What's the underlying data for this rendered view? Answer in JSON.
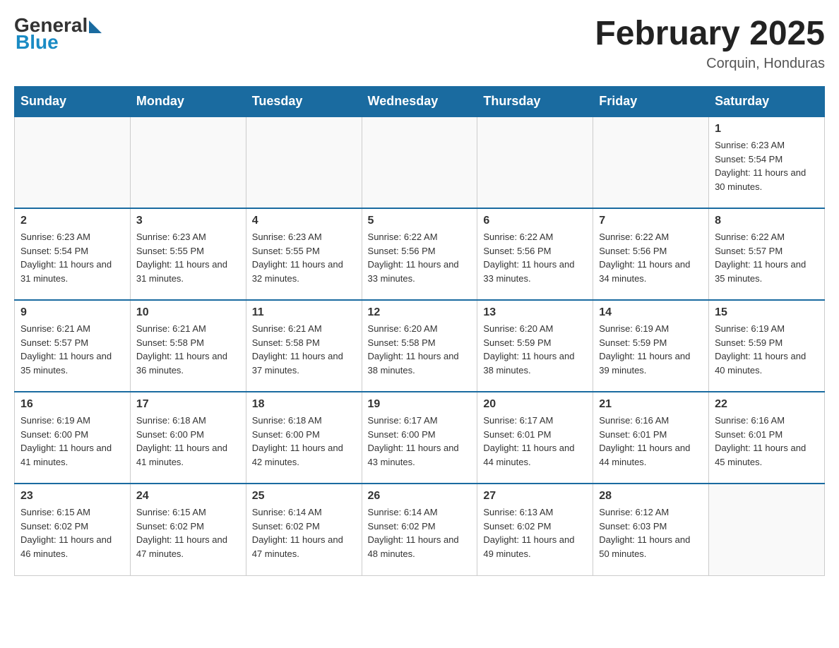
{
  "header": {
    "logo": {
      "general": "General",
      "blue": "Blue"
    },
    "title": "February 2025",
    "location": "Corquin, Honduras"
  },
  "days_of_week": [
    "Sunday",
    "Monday",
    "Tuesday",
    "Wednesday",
    "Thursday",
    "Friday",
    "Saturday"
  ],
  "weeks": [
    [
      {
        "day": "",
        "info": ""
      },
      {
        "day": "",
        "info": ""
      },
      {
        "day": "",
        "info": ""
      },
      {
        "day": "",
        "info": ""
      },
      {
        "day": "",
        "info": ""
      },
      {
        "day": "",
        "info": ""
      },
      {
        "day": "1",
        "sunrise": "Sunrise: 6:23 AM",
        "sunset": "Sunset: 5:54 PM",
        "daylight": "Daylight: 11 hours and 30 minutes."
      }
    ],
    [
      {
        "day": "2",
        "sunrise": "Sunrise: 6:23 AM",
        "sunset": "Sunset: 5:54 PM",
        "daylight": "Daylight: 11 hours and 31 minutes."
      },
      {
        "day": "3",
        "sunrise": "Sunrise: 6:23 AM",
        "sunset": "Sunset: 5:55 PM",
        "daylight": "Daylight: 11 hours and 31 minutes."
      },
      {
        "day": "4",
        "sunrise": "Sunrise: 6:23 AM",
        "sunset": "Sunset: 5:55 PM",
        "daylight": "Daylight: 11 hours and 32 minutes."
      },
      {
        "day": "5",
        "sunrise": "Sunrise: 6:22 AM",
        "sunset": "Sunset: 5:56 PM",
        "daylight": "Daylight: 11 hours and 33 minutes."
      },
      {
        "day": "6",
        "sunrise": "Sunrise: 6:22 AM",
        "sunset": "Sunset: 5:56 PM",
        "daylight": "Daylight: 11 hours and 33 minutes."
      },
      {
        "day": "7",
        "sunrise": "Sunrise: 6:22 AM",
        "sunset": "Sunset: 5:56 PM",
        "daylight": "Daylight: 11 hours and 34 minutes."
      },
      {
        "day": "8",
        "sunrise": "Sunrise: 6:22 AM",
        "sunset": "Sunset: 5:57 PM",
        "daylight": "Daylight: 11 hours and 35 minutes."
      }
    ],
    [
      {
        "day": "9",
        "sunrise": "Sunrise: 6:21 AM",
        "sunset": "Sunset: 5:57 PM",
        "daylight": "Daylight: 11 hours and 35 minutes."
      },
      {
        "day": "10",
        "sunrise": "Sunrise: 6:21 AM",
        "sunset": "Sunset: 5:58 PM",
        "daylight": "Daylight: 11 hours and 36 minutes."
      },
      {
        "day": "11",
        "sunrise": "Sunrise: 6:21 AM",
        "sunset": "Sunset: 5:58 PM",
        "daylight": "Daylight: 11 hours and 37 minutes."
      },
      {
        "day": "12",
        "sunrise": "Sunrise: 6:20 AM",
        "sunset": "Sunset: 5:58 PM",
        "daylight": "Daylight: 11 hours and 38 minutes."
      },
      {
        "day": "13",
        "sunrise": "Sunrise: 6:20 AM",
        "sunset": "Sunset: 5:59 PM",
        "daylight": "Daylight: 11 hours and 38 minutes."
      },
      {
        "day": "14",
        "sunrise": "Sunrise: 6:19 AM",
        "sunset": "Sunset: 5:59 PM",
        "daylight": "Daylight: 11 hours and 39 minutes."
      },
      {
        "day": "15",
        "sunrise": "Sunrise: 6:19 AM",
        "sunset": "Sunset: 5:59 PM",
        "daylight": "Daylight: 11 hours and 40 minutes."
      }
    ],
    [
      {
        "day": "16",
        "sunrise": "Sunrise: 6:19 AM",
        "sunset": "Sunset: 6:00 PM",
        "daylight": "Daylight: 11 hours and 41 minutes."
      },
      {
        "day": "17",
        "sunrise": "Sunrise: 6:18 AM",
        "sunset": "Sunset: 6:00 PM",
        "daylight": "Daylight: 11 hours and 41 minutes."
      },
      {
        "day": "18",
        "sunrise": "Sunrise: 6:18 AM",
        "sunset": "Sunset: 6:00 PM",
        "daylight": "Daylight: 11 hours and 42 minutes."
      },
      {
        "day": "19",
        "sunrise": "Sunrise: 6:17 AM",
        "sunset": "Sunset: 6:00 PM",
        "daylight": "Daylight: 11 hours and 43 minutes."
      },
      {
        "day": "20",
        "sunrise": "Sunrise: 6:17 AM",
        "sunset": "Sunset: 6:01 PM",
        "daylight": "Daylight: 11 hours and 44 minutes."
      },
      {
        "day": "21",
        "sunrise": "Sunrise: 6:16 AM",
        "sunset": "Sunset: 6:01 PM",
        "daylight": "Daylight: 11 hours and 44 minutes."
      },
      {
        "day": "22",
        "sunrise": "Sunrise: 6:16 AM",
        "sunset": "Sunset: 6:01 PM",
        "daylight": "Daylight: 11 hours and 45 minutes."
      }
    ],
    [
      {
        "day": "23",
        "sunrise": "Sunrise: 6:15 AM",
        "sunset": "Sunset: 6:02 PM",
        "daylight": "Daylight: 11 hours and 46 minutes."
      },
      {
        "day": "24",
        "sunrise": "Sunrise: 6:15 AM",
        "sunset": "Sunset: 6:02 PM",
        "daylight": "Daylight: 11 hours and 47 minutes."
      },
      {
        "day": "25",
        "sunrise": "Sunrise: 6:14 AM",
        "sunset": "Sunset: 6:02 PM",
        "daylight": "Daylight: 11 hours and 47 minutes."
      },
      {
        "day": "26",
        "sunrise": "Sunrise: 6:14 AM",
        "sunset": "Sunset: 6:02 PM",
        "daylight": "Daylight: 11 hours and 48 minutes."
      },
      {
        "day": "27",
        "sunrise": "Sunrise: 6:13 AM",
        "sunset": "Sunset: 6:02 PM",
        "daylight": "Daylight: 11 hours and 49 minutes."
      },
      {
        "day": "28",
        "sunrise": "Sunrise: 6:12 AM",
        "sunset": "Sunset: 6:03 PM",
        "daylight": "Daylight: 11 hours and 50 minutes."
      },
      {
        "day": "",
        "info": ""
      }
    ]
  ]
}
